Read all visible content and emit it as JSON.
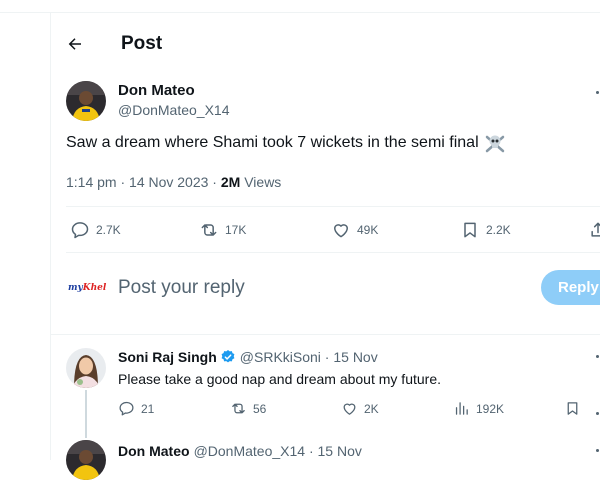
{
  "header": {
    "title": "Post"
  },
  "tweet": {
    "author_name": "Don Mateo",
    "author_handle": "@DonMateo_X14",
    "text": "Saw a dream where Shami took 7 wickets in the semi final",
    "time": "1:14 pm · 14 Nov 2023 · ",
    "views_count": "2M",
    "views_label": " Views",
    "stats": {
      "replies": "2.7K",
      "reposts": "17K",
      "likes": "49K",
      "bookmarks": "2.2K"
    }
  },
  "compose": {
    "logo_main": "my",
    "logo_accent": "Khel",
    "placeholder": "Post your reply",
    "reply_button": "Reply"
  },
  "reply1": {
    "name": "Soni Raj Singh",
    "handle_time": "@SRKkiSoni · 15 Nov",
    "text": "Please take a good nap and dream about my future.",
    "stats": {
      "replies": "21",
      "reposts": "56",
      "likes": "2K",
      "views": "192K"
    }
  },
  "reply2": {
    "name": "Don Mateo",
    "handle_time": "@DonMateo_X14 · 15 Nov"
  },
  "colors": {
    "accent": "#1d9bf0",
    "muted": "#536471",
    "reply_button_bg": "#8ecdf8"
  },
  "icons": [
    "back-arrow-icon",
    "reply-icon",
    "repost-icon",
    "like-icon",
    "bookmark-icon",
    "share-icon",
    "views-icon",
    "verified-badge-icon",
    "skull-emoji-icon",
    "more-icon"
  ]
}
